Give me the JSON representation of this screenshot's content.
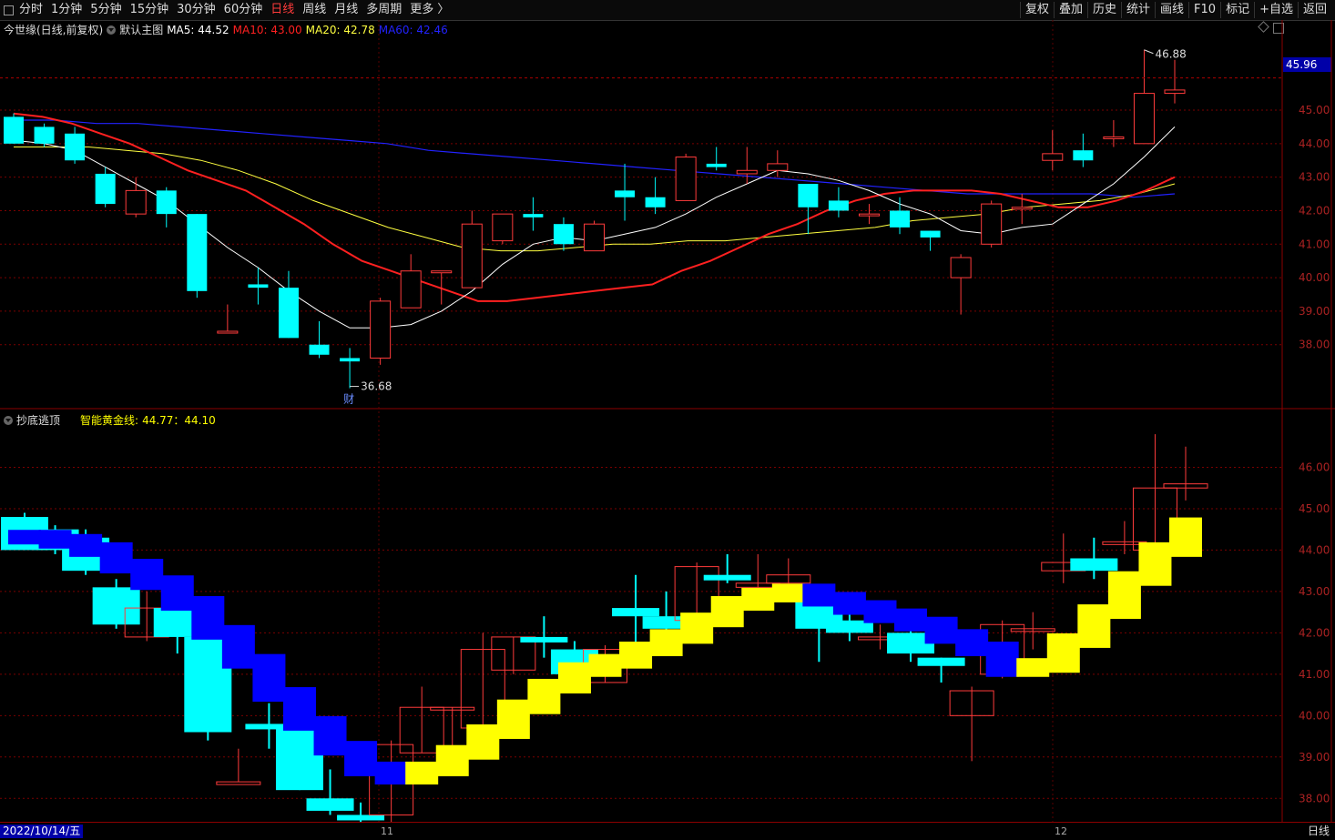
{
  "toolbar": {
    "left_items": [
      "分时",
      "1分钟",
      "5分钟",
      "15分钟",
      "30分钟",
      "60分钟",
      "日线",
      "周线",
      "月线",
      "多周期",
      "更多 〉"
    ],
    "active_index": 6,
    "right_items": [
      "复权",
      "叠加",
      "历史",
      "统计",
      "画线",
      "F10",
      "标记",
      "+自选",
      "返回"
    ]
  },
  "main_panel": {
    "stock_name": "今世缘(日线,前复权)",
    "template_label": "默认主图",
    "ma5": "MA5: 44.52",
    "ma10": "MA10: 43.00",
    "ma20": "MA20: 42.78",
    "ma60": "MA60: 42.46",
    "current_price": "45.96",
    "high_label": "46.88",
    "low_label": "36.68",
    "event_marker": "财",
    "y_ticks": [
      "45.00",
      "44.00",
      "43.00",
      "42.00",
      "41.00",
      "40.00",
      "39.00",
      "38.00"
    ]
  },
  "sub_panel": {
    "indicator_name": "抄底逃顶",
    "formula_label": "智能黄金线:",
    "formula_value": "44.77：44.10",
    "y_ticks": [
      "46.00",
      "45.00",
      "44.00",
      "43.00",
      "42.00",
      "41.00",
      "40.00",
      "39.00",
      "38.00"
    ]
  },
  "bottom": {
    "date": "2022/10/14/五",
    "month_labels": [
      "11",
      "12"
    ],
    "period": "日线"
  },
  "colors": {
    "up": "#ff3b3b",
    "down": "#00ffff",
    "ma5": "#ffffff",
    "ma10": "#ff2020",
    "ma20": "#ffff40",
    "ma60": "#2222ff",
    "gold": "#ffff00",
    "blue_band": "#0000ff",
    "grid": "#7a0000"
  },
  "chart_data": {
    "type": "candlestick",
    "candles": [
      {
        "o": 44.8,
        "h": 44.9,
        "c": 44.0,
        "l": 44.0
      },
      {
        "o": 44.5,
        "h": 44.6,
        "c": 44.0,
        "l": 43.9
      },
      {
        "o": 44.3,
        "h": 44.5,
        "c": 43.5,
        "l": 43.4
      },
      {
        "o": 43.1,
        "h": 43.3,
        "c": 42.2,
        "l": 42.1
      },
      {
        "o": 41.9,
        "h": 43.0,
        "c": 42.6,
        "l": 41.8
      },
      {
        "o": 42.6,
        "h": 42.7,
        "c": 41.9,
        "l": 41.5
      },
      {
        "o": 41.9,
        "h": 41.9,
        "c": 39.6,
        "l": 39.4
      },
      {
        "o": 38.4,
        "h": 39.2,
        "c": 38.4,
        "l": 38.4
      },
      {
        "o": 39.8,
        "h": 40.3,
        "c": 39.7,
        "l": 39.2
      },
      {
        "o": 39.7,
        "h": 40.2,
        "c": 38.2,
        "l": 38.2
      },
      {
        "o": 38.0,
        "h": 38.7,
        "c": 37.7,
        "l": 37.6
      },
      {
        "o": 37.6,
        "h": 37.9,
        "c": 37.5,
        "l": 36.7
      },
      {
        "o": 37.6,
        "h": 39.4,
        "c": 39.3,
        "l": 37.4
      },
      {
        "o": 39.1,
        "h": 40.7,
        "c": 40.2,
        "l": 39.1
      },
      {
        "o": 40.2,
        "h": 40.2,
        "c": 40.2,
        "l": 39.2
      },
      {
        "o": 39.7,
        "h": 42.0,
        "c": 41.6,
        "l": 39.7
      },
      {
        "o": 41.1,
        "h": 41.9,
        "c": 41.9,
        "l": 41.0
      },
      {
        "o": 41.9,
        "h": 42.4,
        "c": 41.8,
        "l": 41.4
      },
      {
        "o": 41.6,
        "h": 41.8,
        "c": 41.0,
        "l": 40.8
      },
      {
        "o": 40.8,
        "h": 41.7,
        "c": 41.6,
        "l": 40.8
      },
      {
        "o": 42.6,
        "h": 43.4,
        "c": 42.4,
        "l": 41.7
      },
      {
        "o": 42.4,
        "h": 43.0,
        "c": 42.1,
        "l": 41.9
      },
      {
        "o": 42.3,
        "h": 43.7,
        "c": 43.6,
        "l": 42.3
      },
      {
        "o": 43.4,
        "h": 43.9,
        "c": 43.3,
        "l": 43.2
      },
      {
        "o": 43.1,
        "h": 43.9,
        "c": 43.2,
        "l": 42.8
      },
      {
        "o": 43.2,
        "h": 43.8,
        "c": 43.4,
        "l": 43.0
      },
      {
        "o": 42.8,
        "h": 42.8,
        "c": 42.1,
        "l": 41.3
      },
      {
        "o": 42.3,
        "h": 42.7,
        "c": 42.0,
        "l": 41.8
      },
      {
        "o": 41.9,
        "h": 42.2,
        "c": 41.9,
        "l": 41.6
      },
      {
        "o": 42.0,
        "h": 42.4,
        "c": 41.5,
        "l": 41.3
      },
      {
        "o": 41.4,
        "h": 41.4,
        "c": 41.2,
        "l": 40.8
      },
      {
        "o": 40.0,
        "h": 40.7,
        "c": 40.6,
        "l": 38.9
      },
      {
        "o": 41.0,
        "h": 42.3,
        "c": 42.2,
        "l": 40.9
      },
      {
        "o": 42.1,
        "h": 42.5,
        "c": 42.1,
        "l": 41.6
      },
      {
        "o": 43.5,
        "h": 44.4,
        "c": 43.7,
        "l": 43.2
      },
      {
        "o": 43.8,
        "h": 44.3,
        "c": 43.5,
        "l": 43.3
      },
      {
        "o": 44.2,
        "h": 44.7,
        "c": 44.2,
        "l": 43.9
      },
      {
        "o": 44.0,
        "h": 46.8,
        "c": 45.5,
        "l": 44.0
      },
      {
        "o": 45.5,
        "h": 46.5,
        "c": 45.6,
        "l": 45.2
      }
    ],
    "ma5": [
      44.1,
      44.0,
      43.8,
      43.3,
      42.8,
      42.3,
      41.6,
      40.9,
      40.3,
      39.6,
      39.0,
      38.5,
      38.5,
      38.6,
      39.0,
      39.6,
      40.4,
      41.0,
      41.2,
      41.1,
      41.3,
      41.5,
      41.9,
      42.4,
      42.8,
      43.2,
      43.1,
      42.9,
      42.6,
      42.2,
      41.9,
      41.4,
      41.3,
      41.5,
      41.6,
      42.2,
      42.8,
      43.6,
      44.5
    ],
    "ma10": [
      44.9,
      44.8,
      44.6,
      44.3,
      44.0,
      43.6,
      43.2,
      42.9,
      42.6,
      42.1,
      41.6,
      41.0,
      40.5,
      40.2,
      39.9,
      39.6,
      39.3,
      39.3,
      39.4,
      39.5,
      39.6,
      39.7,
      39.8,
      40.2,
      40.5,
      40.9,
      41.3,
      41.6,
      42.0,
      42.3,
      42.5,
      42.6,
      42.6,
      42.6,
      42.5,
      42.3,
      42.1,
      42.1,
      42.3,
      42.6,
      43.0
    ],
    "ma20": [
      43.9,
      43.9,
      43.9,
      43.8,
      43.7,
      43.5,
      43.2,
      42.8,
      42.3,
      41.9,
      41.5,
      41.2,
      40.9,
      40.8,
      40.8,
      40.9,
      41.0,
      41.0,
      41.1,
      41.1,
      41.2,
      41.3,
      41.4,
      41.5,
      41.7,
      41.8,
      41.9,
      42.1,
      42.2,
      42.3,
      42.5,
      42.8
    ],
    "ma60": [
      44.7,
      44.7,
      44.6,
      44.6,
      44.5,
      44.4,
      44.3,
      44.2,
      44.1,
      44.0,
      43.8,
      43.7,
      43.6,
      43.5,
      43.4,
      43.3,
      43.2,
      43.1,
      43.0,
      42.9,
      42.8,
      42.7,
      42.6,
      42.5,
      42.5,
      42.5,
      42.5,
      42.4,
      42.5
    ]
  }
}
